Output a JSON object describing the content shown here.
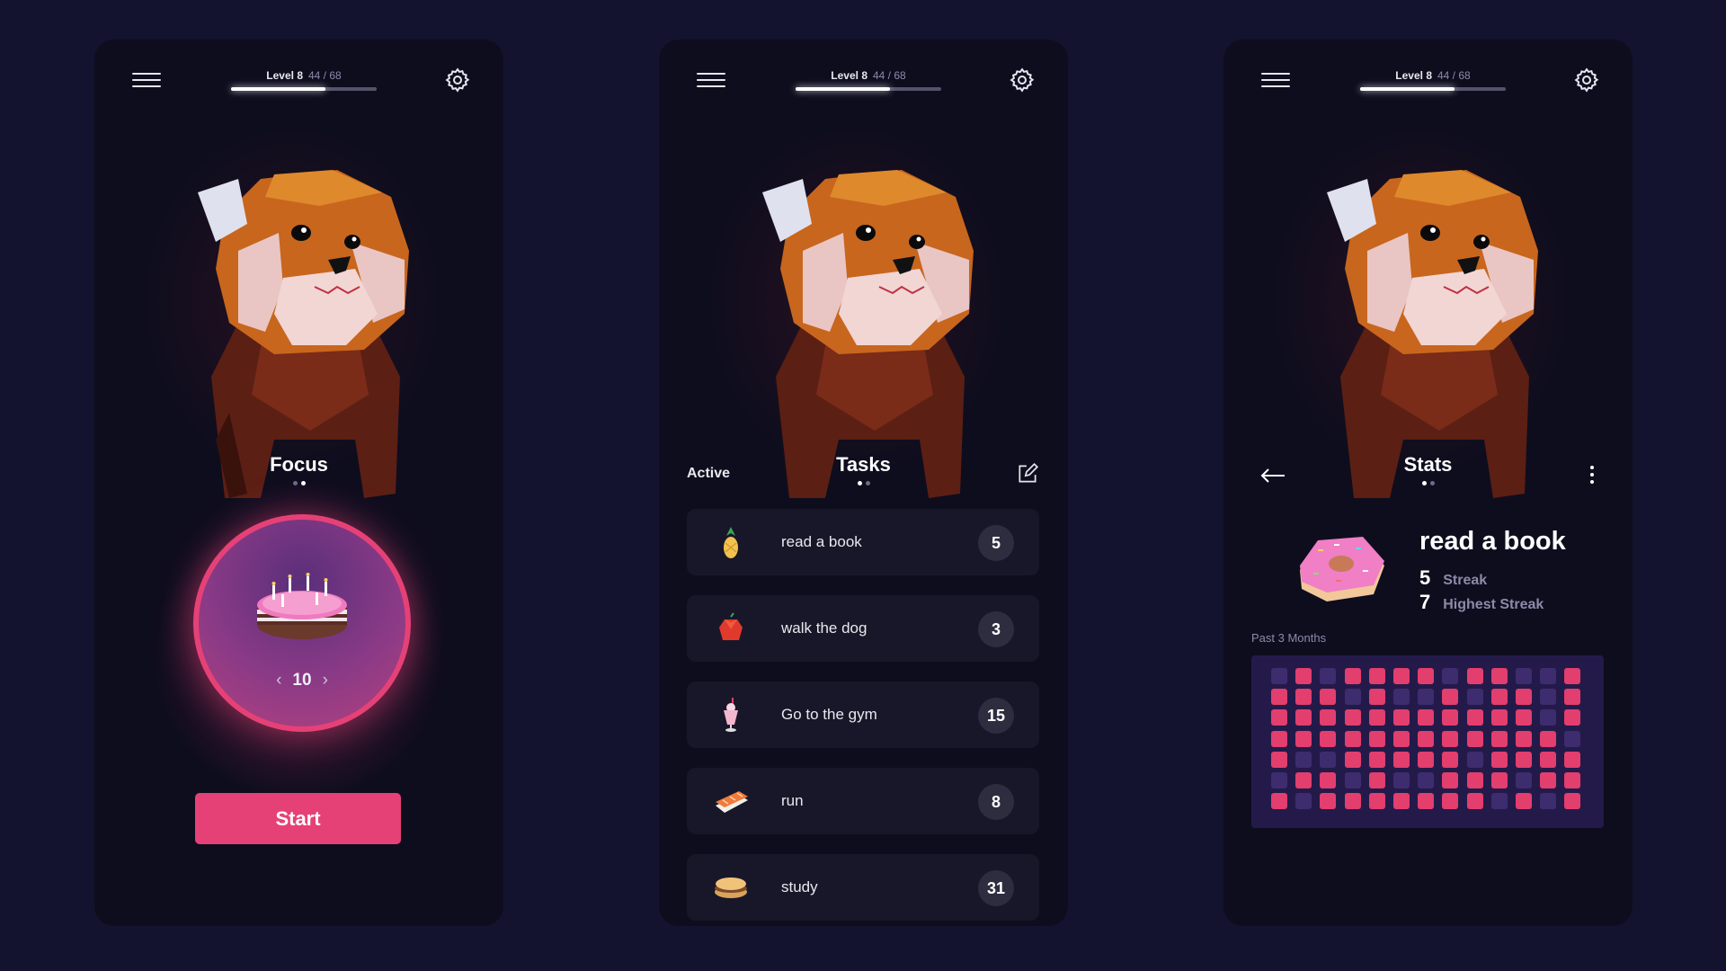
{
  "level": {
    "label": "Level 8",
    "xp": "44 / 68",
    "progress": 0.647
  },
  "focus": {
    "title": "Focus",
    "timer_value": "10",
    "start_label": "Start",
    "prev_icon": "chevron-left",
    "next_icon": "chevron-right"
  },
  "tasks": {
    "title": "Tasks",
    "filter_label": "Active",
    "items": [
      {
        "label": "read a book",
        "count": "5",
        "icon": "pineapple"
      },
      {
        "label": "walk the dog",
        "count": "3",
        "icon": "apple"
      },
      {
        "label": "Go to the gym",
        "count": "15",
        "icon": "milkshake"
      },
      {
        "label": "run",
        "count": "8",
        "icon": "sushi"
      },
      {
        "label": "study",
        "count": "31",
        "icon": "sandwich"
      }
    ]
  },
  "stats": {
    "title": "Stats",
    "habit_title": "read a book",
    "streak_value": "5",
    "streak_label": "Streak",
    "highest_value": "7",
    "highest_label": "Highest Streak",
    "range_label": "Past 3 Months",
    "heatmap_rows": [
      [
        0,
        1,
        0,
        1,
        1,
        1,
        1,
        0,
        1,
        1,
        0,
        0,
        1
      ],
      [
        1,
        1,
        1,
        0,
        1,
        0,
        0,
        1,
        0,
        1,
        1,
        0,
        1
      ],
      [
        1,
        1,
        1,
        1,
        1,
        1,
        1,
        1,
        1,
        1,
        1,
        0,
        1
      ],
      [
        1,
        1,
        1,
        1,
        1,
        1,
        1,
        1,
        1,
        1,
        1,
        1,
        0
      ],
      [
        1,
        0,
        0,
        1,
        1,
        1,
        1,
        1,
        0,
        1,
        1,
        1,
        1
      ],
      [
        0,
        1,
        1,
        0,
        1,
        0,
        0,
        1,
        1,
        1,
        0,
        1,
        1
      ],
      [
        1,
        0,
        1,
        1,
        1,
        1,
        1,
        1,
        1,
        0,
        1,
        0,
        1
      ]
    ]
  },
  "colors": {
    "accent": "#e64176",
    "heat_on": "#e23e6e",
    "heat_off": "#3d2c6e",
    "background": "#14132f",
    "panel": "#0e0d1e"
  }
}
